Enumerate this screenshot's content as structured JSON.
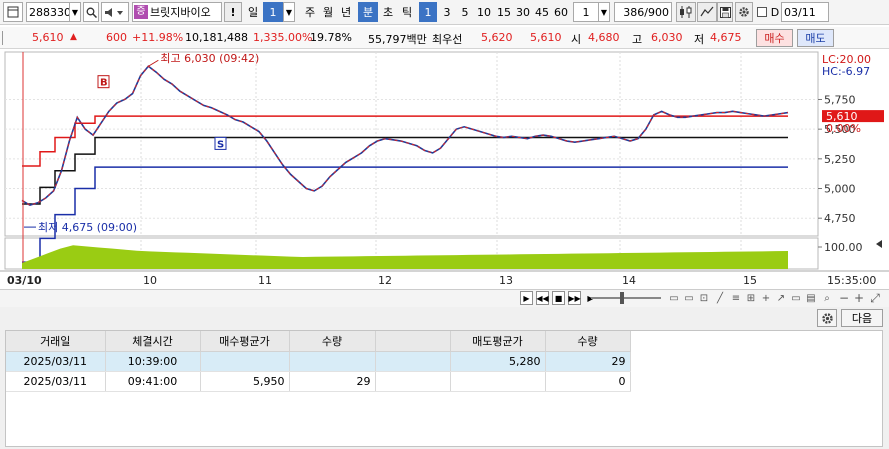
{
  "toolbar": {
    "code": "288330",
    "name": "브릿지바이오",
    "warn": "!",
    "period_value": "1",
    "periods": [
      "일",
      "주",
      "월",
      "년",
      "분",
      "초",
      "틱"
    ],
    "minute_options": [
      "1",
      "3",
      "5",
      "10",
      "15",
      "30",
      "45",
      "60"
    ],
    "interval_value": "1",
    "count": "386",
    "count_max": "/900",
    "date": "03/11"
  },
  "quote": {
    "price": "5,610",
    "change": "600",
    "change_pct": "+11.98%",
    "volume": "10,181,488",
    "volume_ratio": "1,335.00%",
    "turnover": "19.78%",
    "amount": "55,797백만",
    "best_label": "최우선",
    "best_ask": "5,620",
    "best_bid": "5,610",
    "open_label": "시",
    "open": "4,680",
    "high_label": "고",
    "high": "6,030",
    "low_label": "저",
    "low": "4,675",
    "buy_label": "매수",
    "sell_label": "매도"
  },
  "chart_data": {
    "type": "line",
    "title": "",
    "y_range": [
      4600,
      6150
    ],
    "y_ticks": [
      "5,750",
      "5,500",
      "5,250",
      "5,000",
      "4,750"
    ],
    "x_ticks": [
      "03/10",
      "10",
      "11",
      "12",
      "13",
      "14",
      "15"
    ],
    "lc_label": "LC:20.00",
    "hc_label": "HC:-6.97",
    "price_tag": "5,610",
    "zero_pct": "0.00%",
    "volume_tick": "100.00",
    "time_tag": "15:35:00",
    "high_annotation": "최고 6,030 (09:42)",
    "low_annotation": "최저 4,675 (09:00)",
    "buy_marker": "B",
    "sell_marker": "S",
    "series": [
      {
        "values": [
          4900,
          4860,
          4880,
          4920,
          4980,
          5150,
          5400,
          5600,
          5500,
          5450,
          5550,
          5650,
          5720,
          5750,
          5800,
          5950,
          6030,
          5980,
          5920,
          5880,
          5820,
          5780,
          5740,
          5700,
          5680,
          5650,
          5620,
          5580,
          5560,
          5520,
          5480,
          5400,
          5300,
          5200,
          5120,
          5060,
          5000,
          4980,
          5020,
          5100,
          5160,
          5220,
          5260,
          5300,
          5360,
          5400,
          5420,
          5410,
          5400,
          5380,
          5360,
          5320,
          5300,
          5340,
          5420,
          5500,
          5520,
          5500,
          5480,
          5460,
          5440,
          5430,
          5440,
          5430,
          5420,
          5440,
          5450,
          5440,
          5420,
          5400,
          5390,
          5400,
          5410,
          5420,
          5430,
          5440,
          5420,
          5400,
          5420,
          5500,
          5620,
          5650,
          5620,
          5600,
          5600,
          5610,
          5620,
          5630,
          5640,
          5640,
          5650,
          5640,
          5630,
          5620,
          5610,
          5620,
          5630,
          5640
        ]
      }
    ],
    "ma_lines": [
      5610,
      5430,
      5180
    ]
  },
  "trades": {
    "settings_icon": "gear-icon",
    "next_label": "다음",
    "headers": [
      "거래일",
      "체결시간",
      "매수평균가",
      "수량",
      "",
      "매도평균가",
      "수량"
    ],
    "rows": [
      [
        "2025/03/11",
        "10:39:00",
        "",
        "",
        "",
        "5,280",
        "29"
      ],
      [
        "2025/03/11",
        "09:41:00",
        "5,950",
        "29",
        "",
        "",
        "0"
      ]
    ]
  }
}
